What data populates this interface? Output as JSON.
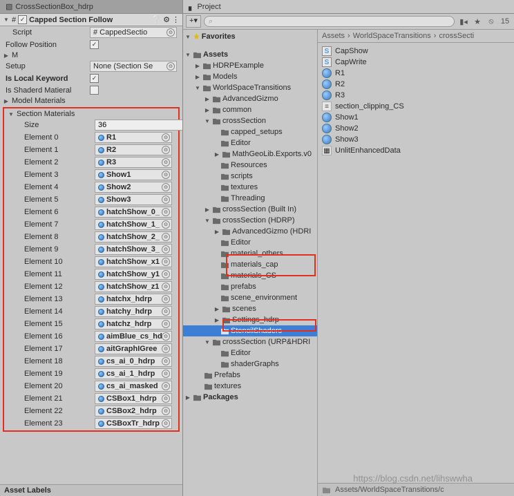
{
  "inspector": {
    "tab_title": "CrossSectionBox_hdrp",
    "component_title": "Capped Section Follow",
    "script_label": "Script",
    "script_value": "CappedSectio",
    "follow_position_label": "Follow Position",
    "follow_position_checked": true,
    "m_label": "M",
    "setup_label": "Setup",
    "setup_value": "None (Section Se",
    "is_local_keyword_label": "Is Local Keyword",
    "is_local_keyword_checked": true,
    "is_shaderd_material_label": "Is Shaderd Matieral",
    "is_shaderd_material_checked": false,
    "model_materials_label": "Model Materials",
    "section_materials_label": "Section Materials",
    "size_label": "Size",
    "size_value": "36",
    "elements": [
      {
        "label": "Element 0",
        "value": "R1"
      },
      {
        "label": "Element 1",
        "value": "R2"
      },
      {
        "label": "Element 2",
        "value": "R3"
      },
      {
        "label": "Element 3",
        "value": "Show1"
      },
      {
        "label": "Element 4",
        "value": "Show2"
      },
      {
        "label": "Element 5",
        "value": "Show3"
      },
      {
        "label": "Element 6",
        "value": "hatchShow_0_"
      },
      {
        "label": "Element 7",
        "value": "hatchShow_1_"
      },
      {
        "label": "Element 8",
        "value": "hatchShow_2_"
      },
      {
        "label": "Element 9",
        "value": "hatchShow_3_"
      },
      {
        "label": "Element 10",
        "value": "hatchShow_x1"
      },
      {
        "label": "Element 11",
        "value": "hatchShow_y1"
      },
      {
        "label": "Element 12",
        "value": "hatchShow_z1"
      },
      {
        "label": "Element 13",
        "value": "hatchx_hdrp"
      },
      {
        "label": "Element 14",
        "value": "hatchy_hdrp"
      },
      {
        "label": "Element 15",
        "value": "hatchz_hdrp"
      },
      {
        "label": "Element 16",
        "value": "aimBlue_cs_hd"
      },
      {
        "label": "Element 17",
        "value": "aitGraphIGree"
      },
      {
        "label": "Element 18",
        "value": "cs_ai_0_hdrp"
      },
      {
        "label": "Element 19",
        "value": "cs_ai_1_hdrp"
      },
      {
        "label": "Element 20",
        "value": "cs_ai_masked"
      },
      {
        "label": "Element 21",
        "value": "CSBox1_hdrp"
      },
      {
        "label": "Element 22",
        "value": "CSBox2_hdrp"
      },
      {
        "label": "Element 23",
        "value": "CSBoxTr_hdrp"
      }
    ],
    "asset_labels": "Asset Labels"
  },
  "project": {
    "tab_title": "Project",
    "visible_count": "15",
    "favorites_label": "Favorites",
    "breadcrumb": [
      "Assets",
      "WorldSpaceTransitions",
      "crossSecti"
    ],
    "tree": {
      "assets": "Assets",
      "hdrp_example": "HDRPExample",
      "models": "Models",
      "wst": "WorldSpaceTransitions",
      "advanced_gizmo": "AdvancedGizmo",
      "common": "common",
      "cross_section": "crossSection",
      "capped_setups": "capped_setups",
      "editor": "Editor",
      "mathgeo": "MathGeoLib.Exports.v0",
      "resources": "Resources",
      "scripts": "scripts",
      "textures": "textures",
      "threading": "Threading",
      "cs_builtin": "crossSection (Built In)",
      "cs_hdrp": "crossSection (HDRP)",
      "adv_gizmo_hdrp": "AdvancedGizmo (HDRI",
      "editor2": "Editor",
      "material_others": "material_others",
      "materials_cap": "materials_cap",
      "materials_cs": "materials_CS",
      "prefabs": "prefabs",
      "scene_env": "scene_environment",
      "scenes": "scenes",
      "settings_hdrp": "Settings_hdrp",
      "stencil_shaders": "StencilShaders",
      "cs_urp": "crossSection (URP&HDRI",
      "editor3": "Editor",
      "shader_graphs": "shaderGraphs",
      "prefabs2": "Prefabs",
      "textures2": "textures",
      "packages": "Packages"
    },
    "assets": [
      {
        "name": "CapShow",
        "type": "shader"
      },
      {
        "name": "CapWrite",
        "type": "shader"
      },
      {
        "name": "R1",
        "type": "material"
      },
      {
        "name": "R2",
        "type": "material"
      },
      {
        "name": "R3",
        "type": "material"
      },
      {
        "name": "section_clipping_CS",
        "type": "cs"
      },
      {
        "name": "Show1",
        "type": "material"
      },
      {
        "name": "Show2",
        "type": "material"
      },
      {
        "name": "Show3",
        "type": "material"
      },
      {
        "name": "UnlitEnhancedData",
        "type": "asset"
      }
    ],
    "footer_path": "Assets/WorldSpaceTransitions/c",
    "watermark": "https://blog.csdn.net/lihswwha"
  }
}
